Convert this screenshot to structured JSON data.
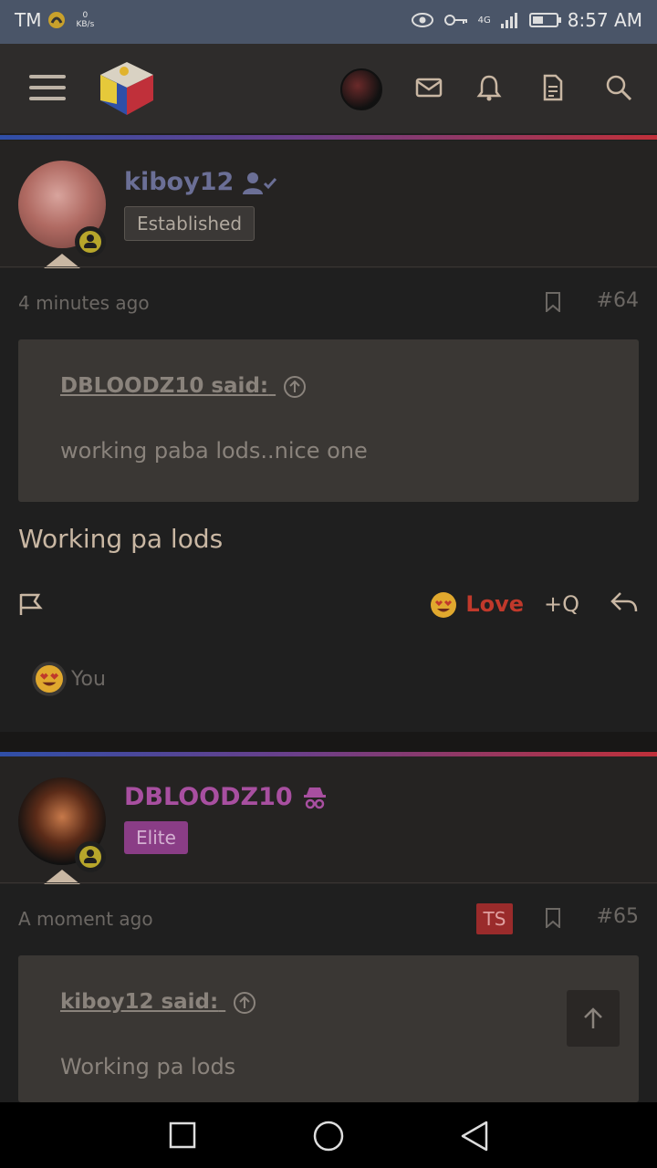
{
  "status_bar": {
    "carrier": "TM",
    "kbs_value": "0",
    "kbs_unit": "KB/s",
    "network": "4G",
    "time": "8:57 AM"
  },
  "posts": [
    {
      "username": "kiboy12",
      "role": "Established",
      "time_ago": "4 minutes ago",
      "post_number": "#64",
      "quote_author": "DBLOODZ10 said:",
      "quote_text": "working paba lods..nice one",
      "body": "Working pa lods",
      "reaction_label": "Love",
      "multiquote_label": "+Q",
      "reactions_by": "You"
    },
    {
      "username": "DBLOODZ10",
      "role": "Elite",
      "time_ago": "A moment ago",
      "ts_badge": "TS",
      "post_number": "#65",
      "quote_author": "kiboy12 said:",
      "quote_text": "Working pa lods"
    }
  ],
  "colors": {
    "accent_established": "#6b6f96",
    "accent_elite": "#a84fa0",
    "love": "#c0392b"
  },
  "icons": [
    "menu-icon",
    "site-logo",
    "mail-icon",
    "bell-icon",
    "document-icon",
    "search-icon",
    "bookmark-icon",
    "flag-icon",
    "reply-icon",
    "arrow-up-icon"
  ]
}
